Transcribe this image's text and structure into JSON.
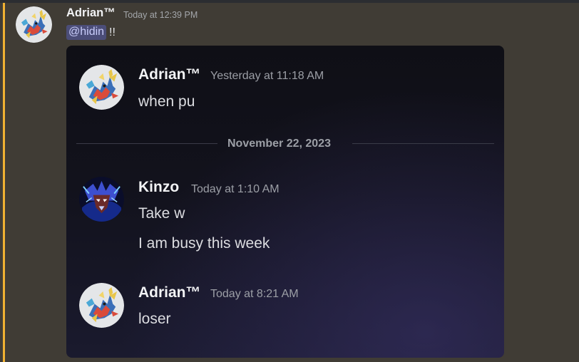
{
  "outer_message": {
    "author": "Adrian™",
    "timestamp": "Today at 12:39 PM",
    "mention": "@hidin",
    "text_after_mention": "!!",
    "avatar_icon": "dragon-avatar-icon"
  },
  "embed": {
    "messages": [
      {
        "author": "Adrian™",
        "timestamp": "Yesterday at 11:18 AM",
        "lines": [
          "when pu"
        ],
        "avatar_icon": "dragon-avatar-icon"
      },
      {
        "author": "Kinzo",
        "timestamp": "Today at 1:10 AM",
        "lines": [
          "Take w",
          "I am busy this week"
        ],
        "avatar_icon": "blue-knight-avatar-icon"
      },
      {
        "author": "Adrian™",
        "timestamp": "Today at 8:21 AM",
        "lines": [
          "loser"
        ],
        "avatar_icon": "dragon-avatar-icon"
      }
    ],
    "date_divider": "November 22, 2023"
  },
  "colors": {
    "background": "#403c35",
    "mention_bar": "#f0b132",
    "mention_bg": "#4b4d78",
    "mention_text": "#c9cdfb"
  }
}
